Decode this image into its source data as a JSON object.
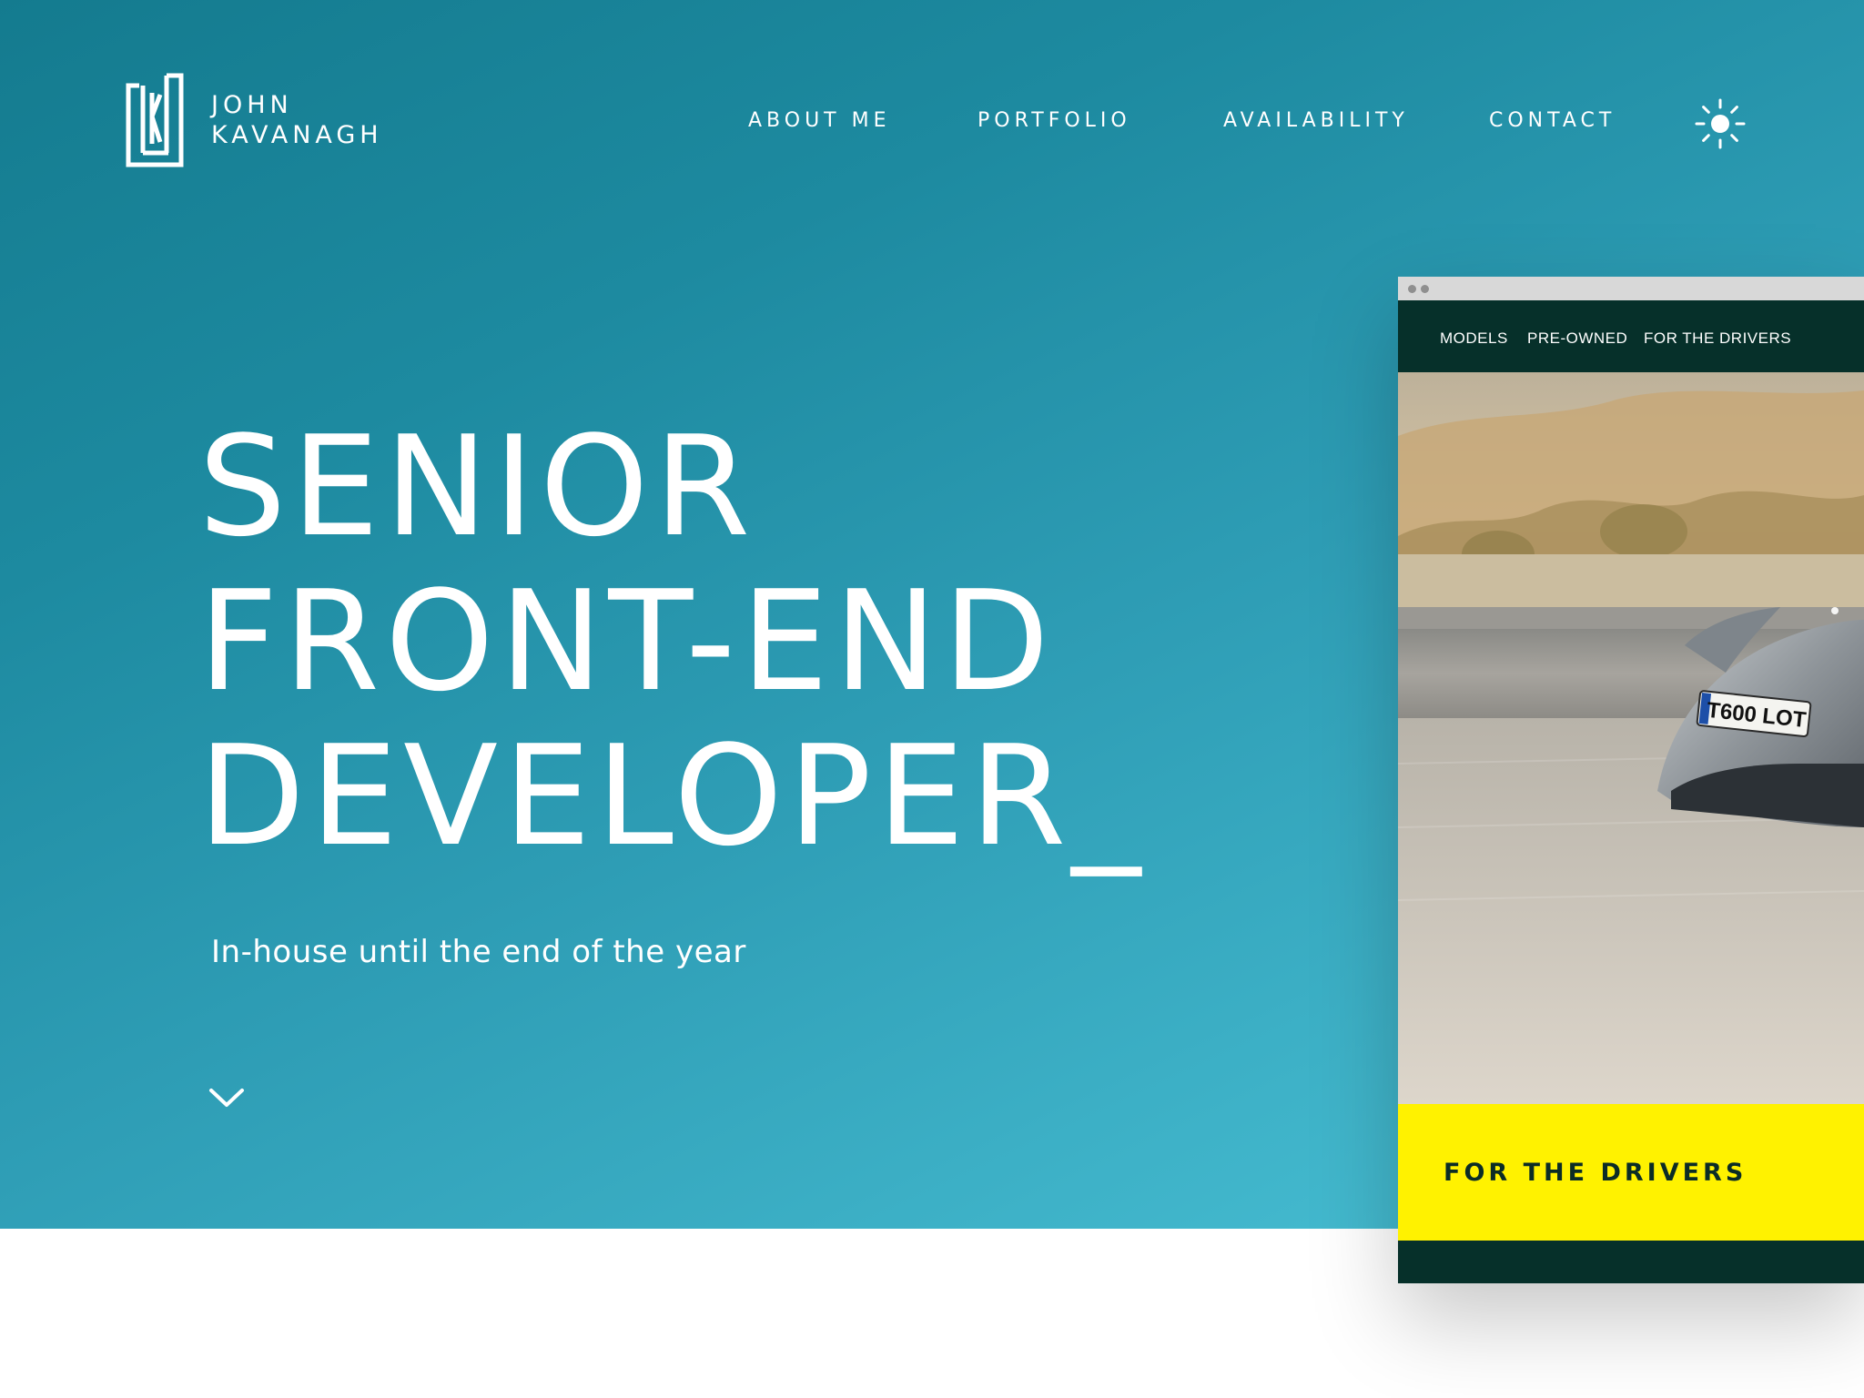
{
  "brand": {
    "first_name": "JOHN",
    "last_name": "KAVANAGH",
    "monogram": "K"
  },
  "nav": {
    "items": [
      {
        "label": "ABOUT ME"
      },
      {
        "label": "PORTFOLIO"
      },
      {
        "label": "AVAILABILITY"
      },
      {
        "label": "CONTACT"
      }
    ],
    "theme_icon": "sun-icon"
  },
  "hero": {
    "headline_lines": [
      "SENIOR",
      "FRONT-END",
      "DEVELOPER_"
    ],
    "subtitle": "In-house until the end of the year",
    "scroll_icon": "chevron-down-icon"
  },
  "mockup": {
    "nav_items": [
      "MODELS",
      "PRE-OWNED",
      "FOR THE DRIVERS"
    ],
    "license_plate": "T600 LOT",
    "banner_label": "FOR THE DRIVERS"
  },
  "colors": {
    "hero_gradient_start": "#147b8f",
    "hero_gradient_end": "#4ac2d6",
    "mockup_dark": "#06302a",
    "mockup_accent": "#fff200",
    "text_light": "#ffffff"
  }
}
